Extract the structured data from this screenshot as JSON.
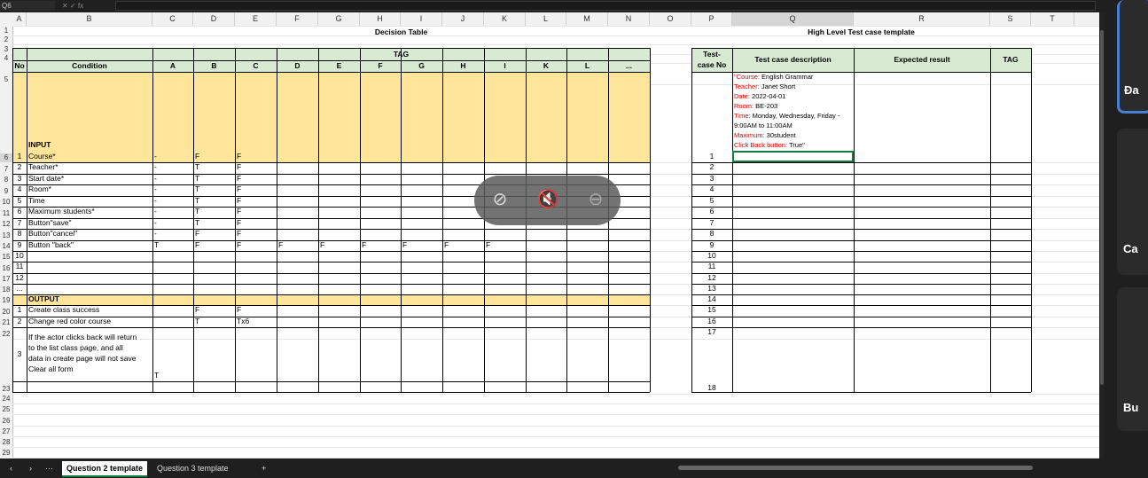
{
  "formula_bar": {
    "namebox": "Q6",
    "fx": "fx"
  },
  "columns": [
    "A",
    "B",
    "C",
    "D",
    "E",
    "F",
    "G",
    "H",
    "I",
    "J",
    "K",
    "L",
    "M",
    "N",
    "O",
    "P",
    "Q",
    "R",
    "S",
    "T"
  ],
  "rows": [
    "1",
    "2",
    "3",
    "4",
    "5",
    "6",
    "7",
    "8",
    "9",
    "10",
    "11",
    "12",
    "13",
    "14",
    "15",
    "16",
    "17",
    "18",
    "19",
    "20",
    "21",
    "22",
    "23",
    "24",
    "25",
    "26",
    "27",
    "28",
    "29"
  ],
  "decision": {
    "title": "Decision Table",
    "tag": "TAG",
    "no": "No",
    "condition": "Condition",
    "tag_cols": [
      "A",
      "B",
      "C",
      "D",
      "E",
      "F",
      "G",
      "H",
      "I",
      "K",
      "L",
      "..."
    ],
    "input": "INPUT",
    "output": "OUTPUT",
    "input_rows": [
      {
        "no": "1",
        "cond": "Course*",
        "vals": [
          "-",
          "F",
          "F",
          "",
          "",
          "",
          "",
          "",
          "",
          "",
          "",
          ""
        ]
      },
      {
        "no": "2",
        "cond": "Teacher*",
        "vals": [
          "-",
          "T",
          "F",
          "",
          "",
          "",
          "",
          "",
          "",
          "",
          "",
          ""
        ]
      },
      {
        "no": "3",
        "cond": "Start date*",
        "vals": [
          "-",
          "T",
          "F",
          "",
          "",
          "",
          "",
          "",
          "",
          "",
          "",
          ""
        ]
      },
      {
        "no": "4",
        "cond": "Room*",
        "vals": [
          "-",
          "T",
          "F",
          "",
          "",
          "",
          "",
          "",
          "",
          "",
          "",
          ""
        ]
      },
      {
        "no": "5",
        "cond": "Time",
        "vals": [
          "-",
          "T",
          "F",
          "",
          "",
          "",
          "",
          "",
          "",
          "",
          "",
          ""
        ]
      },
      {
        "no": "6",
        "cond": "Maximum students*",
        "vals": [
          "-",
          "T",
          "F",
          "",
          "",
          "",
          "",
          "",
          "",
          "",
          "",
          ""
        ]
      },
      {
        "no": "7",
        "cond": "Button\"save\"",
        "vals": [
          "-",
          "T",
          "F",
          "",
          "",
          "",
          "",
          "",
          "",
          "",
          "",
          ""
        ]
      },
      {
        "no": "8",
        "cond": "Button\"cancel\"",
        "vals": [
          "-",
          "F",
          "F",
          "",
          "",
          "",
          "",
          "",
          "",
          "",
          "",
          ""
        ]
      },
      {
        "no": "9",
        "cond": "Button \"back\"",
        "vals": [
          "T",
          "F",
          "F",
          "F",
          "F",
          "F",
          "F",
          "F",
          "F",
          "",
          "",
          ""
        ]
      },
      {
        "no": "10",
        "cond": "",
        "vals": [
          "",
          "",
          "",
          "",
          "",
          "",
          "",
          "",
          "",
          "",
          "",
          ""
        ]
      },
      {
        "no": "11",
        "cond": "",
        "vals": [
          "",
          "",
          "",
          "",
          "",
          "",
          "",
          "",
          "",
          "",
          "",
          ""
        ]
      },
      {
        "no": "12",
        "cond": "",
        "vals": [
          "",
          "",
          "",
          "",
          "",
          "",
          "",
          "",
          "",
          "",
          "",
          ""
        ]
      },
      {
        "no": "...",
        "cond": "",
        "vals": [
          "",
          "",
          "",
          "",
          "",
          "",
          "",
          "",
          "",
          "",
          "",
          ""
        ]
      }
    ],
    "output_rows": [
      {
        "no": "1",
        "cond": "Create class success",
        "vals": [
          "",
          "F",
          "F"
        ]
      },
      {
        "no": "2",
        "cond": "Change red color course",
        "vals": [
          "",
          "T",
          "Tx6"
        ]
      }
    ],
    "out3": {
      "no": "3",
      "lines": [
        "If the actor clicks back will return",
        "to the list class page, and all",
        "data in create page will not save",
        "Clear all form"
      ],
      "val": "T"
    }
  },
  "highlevel": {
    "title": "High Level Test case template",
    "col_no": [
      "Test-",
      "case No"
    ],
    "col_desc": "Test case description",
    "col_exp": "Expected result",
    "col_tag": "TAG",
    "desc1": [
      {
        "label": "Course:",
        "value": " English Grammar",
        "prefix": "\""
      },
      {
        "label": "Teacher:",
        "value": " Janet Short"
      },
      {
        "label": "Date:",
        "value": " 2022-04-01"
      },
      {
        "label": "Room:",
        "value": " BE-203"
      },
      {
        "label": "Time:",
        "value": " Monday, Wednesday, Friday -"
      },
      {
        "label": "",
        "value": "9:00AM to 11:00AM"
      },
      {
        "label": "Maximum:",
        "value": " 30student"
      },
      {
        "label": "Click Back button:",
        "value": " True\""
      }
    ],
    "numbers": [
      "1",
      "2",
      "3",
      "4",
      "5",
      "6",
      "7",
      "8",
      "9",
      "10",
      "11",
      "12",
      "13",
      "14",
      "15",
      "16",
      "17",
      "18"
    ]
  },
  "tabs": [
    "Question 2 template",
    "Question 3 template"
  ],
  "tab_nav": {
    "prev": "‹",
    "next": "›",
    "more": "···",
    "add": "+"
  },
  "right_panel": [
    "Đa",
    "Ca",
    "Bu"
  ]
}
